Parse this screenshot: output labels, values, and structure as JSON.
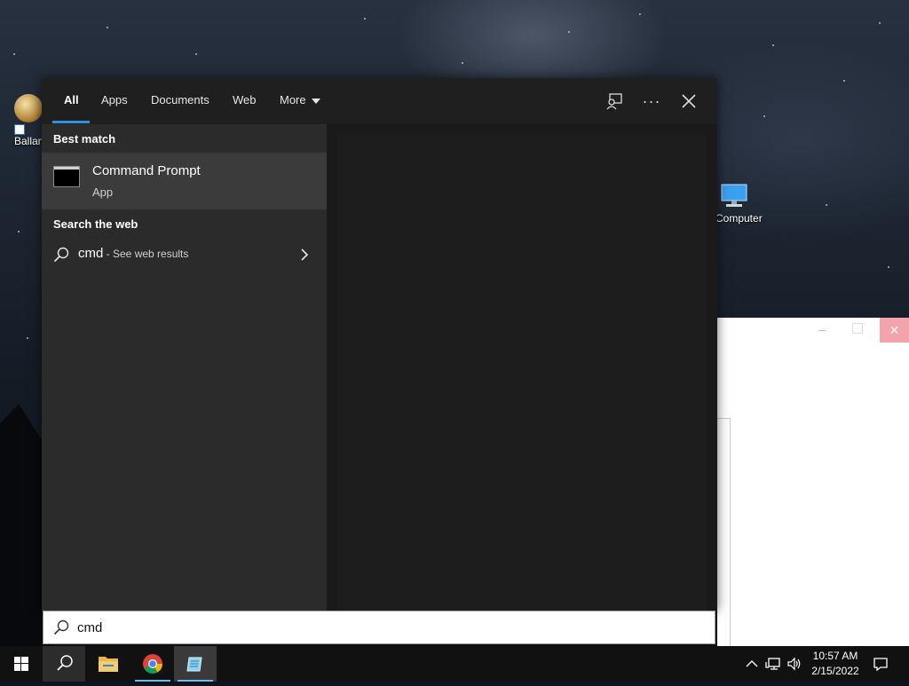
{
  "desktop": {
    "icons": [
      {
        "label": "Ballan"
      },
      {
        "label": "Computer"
      }
    ]
  },
  "search_panel": {
    "tabs": [
      {
        "label": "All",
        "active": true
      },
      {
        "label": "Apps"
      },
      {
        "label": "Documents"
      },
      {
        "label": "Web"
      },
      {
        "label": "More"
      }
    ],
    "toolbar": {
      "feedback_icon": "feedback-icon",
      "options_glyph": "···",
      "close_glyph": "✕"
    },
    "best_match": {
      "section_title": "Best match",
      "name": "Command Prompt",
      "type": "App"
    },
    "web": {
      "section_title": "Search the web",
      "query": "cmd",
      "hint": " - See web results"
    }
  },
  "search_box": {
    "value": "cmd"
  },
  "taskbar": {
    "clock": {
      "time": "10:57 AM",
      "date": "2/15/2022"
    }
  },
  "colors": {
    "accent": "#2f8fe0",
    "panel_bg": "#1f1f1f",
    "left_pane_bg": "#2b2b2b",
    "selected_bg": "#3b3b3b"
  }
}
